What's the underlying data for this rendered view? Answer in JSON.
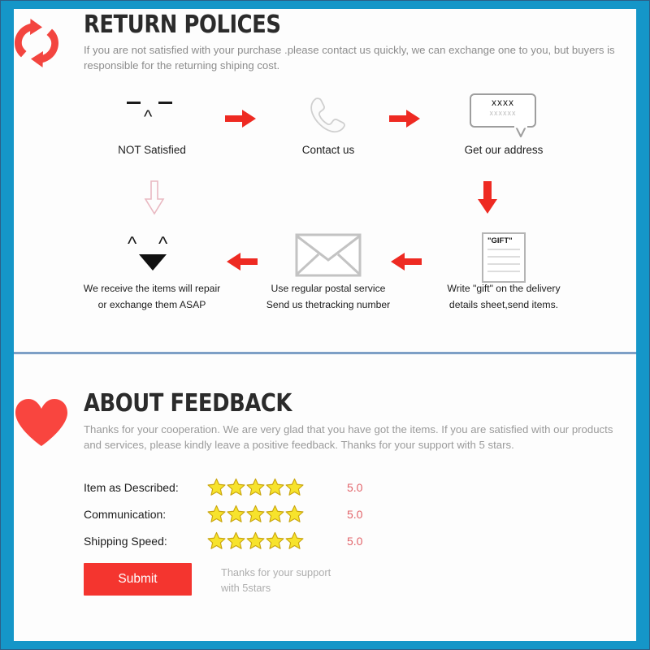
{
  "theme": {
    "border_blue": "#1596c8",
    "accent_red": "#f4352f",
    "divider_blue": "#7d9fc6",
    "star_yellow": "#f7e32c",
    "star_outline": "#c9a50d",
    "score_red": "#e2656b",
    "muted_gray": "#9a9a9a"
  },
  "return_section": {
    "icon": "return-refresh-icon",
    "title": "RETURN POLICES",
    "description": "If you are not satisfied with your purchase .please contact us quickly, we can exchange one to you, but buyers is responsible for the returning shiping cost.",
    "row1": [
      {
        "icon": "sad-face-icon",
        "caption": "NOT Satisfied"
      },
      {
        "icon": "telephone-icon",
        "caption": "Contact us"
      },
      {
        "icon": "speech-bubble-icon",
        "caption": "Get our address",
        "bubble_line1": "xxxx",
        "bubble_line2": "xxxxxx"
      }
    ],
    "row1_arrows": [
      "arrow-right-red",
      "arrow-right-red"
    ],
    "mid_arrows": [
      "arrow-down-outline-pink",
      "arrow-down-solid-red"
    ],
    "row2": [
      {
        "icon": "happy-face-icon",
        "caption_line1": "We receive the items will repair",
        "caption_line2": "or exchange them ASAP"
      },
      {
        "icon": "envelope-icon",
        "caption_line1": "Use regular postal service",
        "caption_line2": "Send us thetracking number"
      },
      {
        "icon": "gift-note-icon",
        "caption_line1": "Write \"gift\" on the delivery",
        "caption_line2": "details sheet,send items.",
        "note_title": "\"GIFT\""
      }
    ],
    "row2_arrows": [
      "arrow-left-red",
      "arrow-left-red"
    ]
  },
  "feedback_section": {
    "icon": "heart-icon",
    "title": "ABOUT FEEDBACK",
    "description": "Thanks for your cooperation. We are very glad that you have got the items. If you are satisfied with our products and services, please kindly leave a positive feedback. Thanks for your support with 5 stars.",
    "ratings": [
      {
        "label": "Item as Described:",
        "stars": 5,
        "score": "5.0"
      },
      {
        "label": "Communication:",
        "stars": 5,
        "score": "5.0"
      },
      {
        "label": "Shipping Speed:",
        "stars": 5,
        "score": "5.0"
      }
    ],
    "submit_label": "Submit",
    "submit_note_line1": "Thanks for your support",
    "submit_note_line2": "with 5stars"
  }
}
